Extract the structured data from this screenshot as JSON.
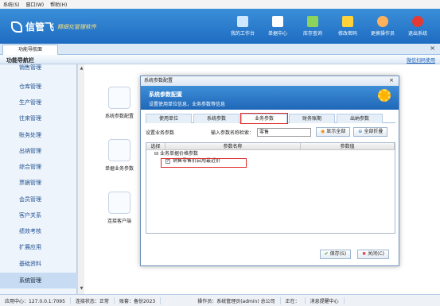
{
  "menu": {
    "items": [
      "系统(S)",
      "窗口(W)",
      "帮助(H)"
    ]
  },
  "app": {
    "brand": "信管飞",
    "slogan": "精细化管理软件"
  },
  "toolbar": {
    "items": [
      "我的工作台",
      "单据中心",
      "库存查询",
      "修改密码",
      "更换操作员",
      "退出系统"
    ]
  },
  "tabstrip": {
    "tab": "功能导航面",
    "close": "×"
  },
  "nav": {
    "title": "功能导航栏",
    "link": "微信扫码使用"
  },
  "sidebar": {
    "items": [
      "销售管理",
      "仓库管理",
      "生产管理",
      "往来管理",
      "账务处理",
      "出纳管理",
      "综合管理",
      "票据管理",
      "会员管理",
      "客户关系",
      "绩效考核",
      "扩展应用",
      "基础资料",
      "系统管理"
    ],
    "active_index": 13
  },
  "cards": {
    "items": [
      "系统参数配置",
      "单据业务参数",
      "连接客户端"
    ]
  },
  "dialog": {
    "title": "系统参数配置",
    "close": "×",
    "header_title": "系统参数配置",
    "header_sub": "设置使用单位信息，业务参数等信息",
    "tabs": [
      "使用单位",
      "系统参数",
      "业务参数",
      "财务账期",
      "出纳参数"
    ],
    "active_tab": 2,
    "search_left": "设置业务参数",
    "search_label": "输入参数名称检索：",
    "search_value": "零售",
    "btn_show_all": "显示全部",
    "btn_collapse": "全部折叠",
    "columns": [
      "选择",
      "参数名称",
      "参数值"
    ],
    "group": "业务单据价格参数",
    "row": "销售零售价启用最近价",
    "save": "保存(S)",
    "close_btn": "关闭(C)"
  },
  "status": {
    "items": [
      "应用中心：127.0.0.1:7095",
      "连接状态：正常",
      "账套：备份2023",
      "操作员：系统管理员(admin) 总公司",
      "正在：",
      "消息提醒中心"
    ]
  },
  "colors": {
    "brand_blue": "#1e6cc2",
    "highlight_red": "#e12a2a",
    "sidebar_bg": "#eef4fb"
  }
}
